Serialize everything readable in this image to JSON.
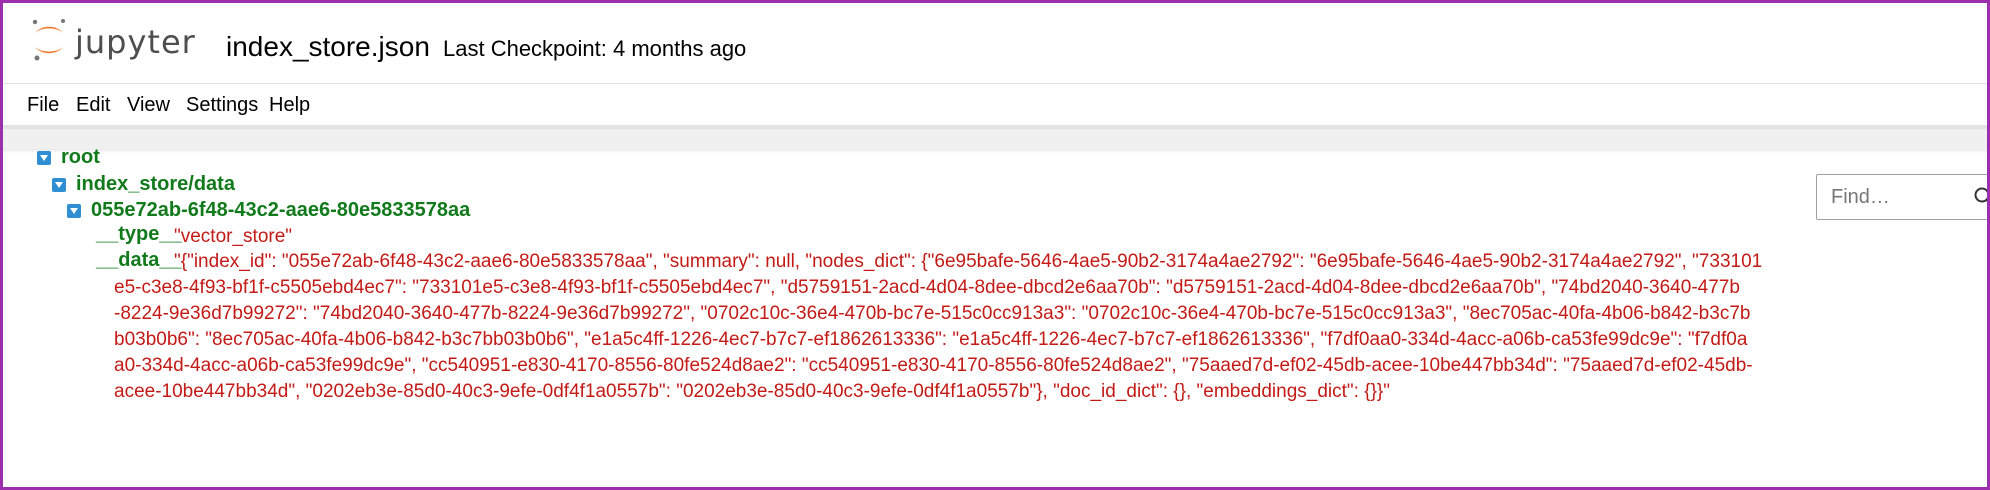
{
  "header": {
    "brand": "jupyter",
    "filename": "index_store.json",
    "checkpoint": "Last Checkpoint: 4 months ago"
  },
  "menu": [
    "File",
    "Edit",
    "View",
    "Settings",
    "Help"
  ],
  "find": {
    "placeholder": "Find…"
  },
  "tree": {
    "root_label": "root",
    "level1_label": "index_store/data",
    "level2_label": "055e72ab-6f48-43c2-aae6-80e5833578aa",
    "type_key": "__type__",
    "type_value": "\"vector_store\"",
    "data_key": "__data__",
    "data_lines": [
      "\"{\"index_id\": \"055e72ab-6f48-43c2-aae6-80e5833578aa\", \"summary\": null, \"nodes_dict\": {\"6e95bafe-5646-4ae5-90b2-3174a4ae2792\": \"6e95bafe-5646-4ae5-90b2-3174a4ae2792\", \"733101",
      "e5-c3e8-4f93-bf1f-c5505ebd4ec7\": \"733101e5-c3e8-4f93-bf1f-c5505ebd4ec7\", \"d5759151-2acd-4d04-8dee-dbcd2e6aa70b\": \"d5759151-2acd-4d04-8dee-dbcd2e6aa70b\", \"74bd2040-3640-477b",
      "-8224-9e36d7b99272\": \"74bd2040-3640-477b-8224-9e36d7b99272\", \"0702c10c-36e4-470b-bc7e-515c0cc913a3\": \"0702c10c-36e4-470b-bc7e-515c0cc913a3\", \"8ec705ac-40fa-4b06-b842-b3c7b",
      "b03b0b6\": \"8ec705ac-40fa-4b06-b842-b3c7bb03b0b6\", \"e1a5c4ff-1226-4ec7-b7c7-ef1862613336\": \"e1a5c4ff-1226-4ec7-b7c7-ef1862613336\", \"f7df0aa0-334d-4acc-a06b-ca53fe99dc9e\": \"f7df0a",
      "a0-334d-4acc-a06b-ca53fe99dc9e\", \"cc540951-e830-4170-8556-80fe524d8ae2\": \"cc540951-e830-4170-8556-80fe524d8ae2\", \"75aaed7d-ef02-45db-acee-10be447bb34d\": \"75aaed7d-ef02-45db-",
      "acee-10be447bb34d\", \"0202eb3e-85d0-40c3-9efe-0df4f1a0557b\": \"0202eb3e-85d0-40c3-9efe-0df4f1a0557b\"}, \"doc_id_dict\": {}, \"embeddings_dict\": {}}\""
    ]
  },
  "colors": {
    "frame": "#9b2fae",
    "logo_orange": "#f37726",
    "key_green": "#117a1b",
    "value_red": "#c41a16",
    "caret_blue": "#2f8fd2"
  }
}
